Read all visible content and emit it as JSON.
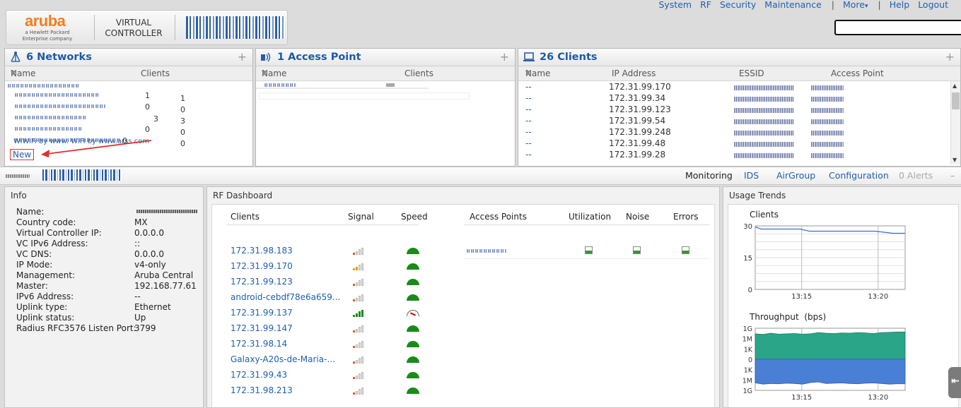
{
  "header": {
    "brand": "aruba",
    "brand_sub": "a Hewlett Packard Enterprise company",
    "product_line1": "VIRTUAL",
    "product_line2": "CONTROLLER",
    "nav": {
      "system": "System",
      "rf": "RF",
      "security": "Security",
      "maintenance": "Maintenance",
      "more": "More",
      "help": "Help",
      "logout": "Logout"
    },
    "search_value": ""
  },
  "networks": {
    "title": "6 Networks",
    "col_name": "Name",
    "col_clients": "Clients",
    "last_row": "WiWiFi by www. WiFi by www.arss.com",
    "counts": [
      [
        "1",
        "1"
      ],
      [
        "0",
        "0"
      ],
      [
        "3",
        "3"
      ],
      [
        "0",
        "0"
      ],
      [
        "0",
        "0"
      ],
      [
        "0",
        "0"
      ]
    ],
    "new_label": "New"
  },
  "access_points": {
    "title": "1 Access Point",
    "col_name": "Name",
    "col_clients": "Clients"
  },
  "clients": {
    "title": "26 Clients",
    "col_name": "Name",
    "col_ip": "IP Address",
    "col_essid": "ESSID",
    "col_ap": "Access Point",
    "rows": [
      {
        "name": "--",
        "ip": "172.31.99.170"
      },
      {
        "name": "--",
        "ip": "172.31.99.34"
      },
      {
        "name": "--",
        "ip": "172.31.99.123"
      },
      {
        "name": "--",
        "ip": "172.31.99.54"
      },
      {
        "name": "--",
        "ip": "172.31.99.248"
      },
      {
        "name": "--",
        "ip": "172.31.99.48"
      },
      {
        "name": "--",
        "ip": "172.31.99.28"
      }
    ]
  },
  "tabs": {
    "monitoring": "Monitoring",
    "ids": "IDS",
    "airgroup": "AirGroup",
    "configuration": "Configuration",
    "alerts": "0 Alerts"
  },
  "info": {
    "title": "Info",
    "rows": [
      {
        "label": "Name:",
        "value": ""
      },
      {
        "label": "Country code:",
        "value": "MX"
      },
      {
        "label": "Virtual Controller IP:",
        "value": "0.0.0.0"
      },
      {
        "label": "VC IPv6 Address:",
        "value": "::"
      },
      {
        "label": "VC DNS:",
        "value": "0.0.0.0"
      },
      {
        "label": "IP Mode:",
        "value": "v4-only"
      },
      {
        "label": "Management:",
        "value": "Aruba Central"
      },
      {
        "label": "Master:",
        "value": "192.168.77.61"
      },
      {
        "label": "IPv6 Address:",
        "value": "--"
      },
      {
        "label": "Uplink type:",
        "value": "Ethernet"
      },
      {
        "label": "Uplink status:",
        "value": "Up"
      },
      {
        "label": "Radius RFC3576 Listen Port:",
        "value": "3799"
      }
    ]
  },
  "rf": {
    "title": "RF Dashboard",
    "col_clients": "Clients",
    "col_signal": "Signal",
    "col_speed": "Speed",
    "col_aps": "Access Points",
    "col_util": "Utilization",
    "col_noise": "Noise",
    "col_errors": "Errors",
    "clients": [
      {
        "name": "172.31.98.183",
        "signal": 1,
        "speed": "ok"
      },
      {
        "name": "172.31.99.170",
        "signal": 2,
        "speed": "ok"
      },
      {
        "name": "172.31.99.123",
        "signal": 1,
        "speed": "ok"
      },
      {
        "name": "android-cebdf78e6a659...",
        "signal": 1,
        "speed": "ok"
      },
      {
        "name": "172.31.99.137",
        "signal": 4,
        "speed": "low"
      },
      {
        "name": "172.31.99.147",
        "signal": 1,
        "speed": "ok"
      },
      {
        "name": "172.31.98.14",
        "signal": 1,
        "speed": "ok"
      },
      {
        "name": "Galaxy-A20s-de-Maria-...",
        "signal": 1,
        "speed": "ok"
      },
      {
        "name": "172.31.99.43",
        "signal": 1,
        "speed": "ok"
      },
      {
        "name": "172.31.98.213",
        "signal": 1,
        "speed": "ok"
      }
    ],
    "signal_colors": {
      "low": "#e05a1a",
      "mid": "#e0a020",
      "high": "#1e8a1e"
    }
  },
  "usage": {
    "title": "Usage Trends",
    "clients_label": "Clients",
    "throughput_label": "Throughput",
    "throughput_unit": "(bps)",
    "clients_y_ticks": [
      "30",
      "15",
      "0"
    ],
    "x_ticks": [
      "13:15",
      "13:20"
    ],
    "throughput_y_ticks": [
      "1G",
      "1M",
      "1K",
      "0",
      "1K",
      "1M",
      "1G"
    ],
    "clients_line_color": "#3b6fc8",
    "upload_color": "#2aa587",
    "download_color": "#4a7fd6"
  }
}
